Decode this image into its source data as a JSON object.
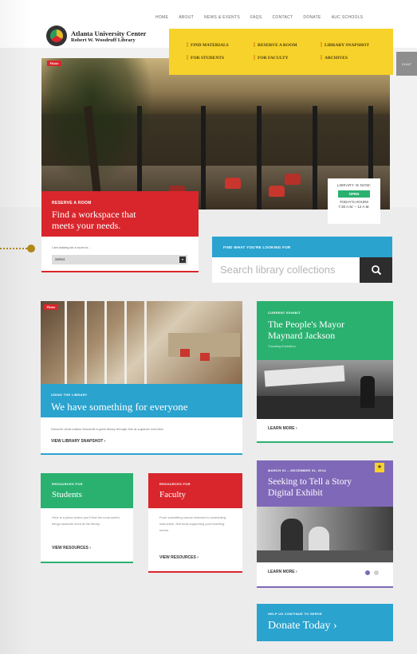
{
  "topnav": [
    "HOME",
    "ABOUT",
    "NEWS & EVENTS",
    "FAQS",
    "CONTACT",
    "DONATE",
    "AUC SCHOOLS"
  ],
  "logo": {
    "line1": "Atlanta University Center",
    "line2": "Robert W. Woodruff Library"
  },
  "menu": {
    "find_materials": "FIND MATERIALS",
    "reserve_room": "RESERVE A ROOM",
    "library_snapshot": "LIBRARY SNAPSHOT",
    "for_students": "FOR STUDENTS",
    "for_faculty": "FOR FACULTY",
    "archives": "ARCHIVES"
  },
  "chat_tab": "CHAT",
  "hero": {
    "tag": "Flickr"
  },
  "library_status": {
    "label": "LIBRARY IS NOW:",
    "state": "OPEN",
    "hours_label": "TODAY'S HOURS",
    "hours": "7:30 A.M. – 12 A.M."
  },
  "reserve": {
    "eyebrow": "RESERVE A ROOM",
    "headline_1": "Find a workspace that",
    "headline_2": "meets your needs.",
    "select_label": "I am looking for a room to...",
    "select_value": "Select"
  },
  "search": {
    "eyebrow": "FIND WHAT YOU'RE LOOKING FOR",
    "placeholder": "Search library collections"
  },
  "using": {
    "tag": "Flickr",
    "eyebrow": "USING THE LIBRARY",
    "headline": "We have something for everyone",
    "desc": "Discover what makes Woodruff a great library through this at-a-glance overview.",
    "link": "VIEW LIBRARY SNAPSHOT ›"
  },
  "exhibit": {
    "eyebrow": "CURRENT EXHIBIT",
    "headline_1": "The People's Mayor",
    "headline_2": "Maynard Jackson",
    "sub": "Traveling Exhibition",
    "link": "LEARN MORE ›"
  },
  "students": {
    "eyebrow": "RESOURCES FOR",
    "headline": "Students",
    "desc": "Here is a place where you'll find the most useful things students need at the library.",
    "link": "VIEW RESOURCES ›"
  },
  "faculty": {
    "eyebrow": "RESOURCES FOR",
    "headline": "Faculty",
    "desc": "From submitting course reserves to scheduling instruction, find tools supporting your teaching needs.",
    "link": "VIEW RESOURCES ›"
  },
  "story": {
    "star": "★",
    "eyebrow": "MARCH 01 – DECEMBER 31, 2014",
    "headline_1": "Seeking to Tell a Story",
    "headline_2": "Digital Exhibit",
    "link": "LEARN MORE ›"
  },
  "donate": {
    "eyebrow": "HELP US CONTINUE TO SERVE",
    "headline": "Donate Today ›"
  },
  "colors": {
    "red": "#d9262c",
    "yellow": "#f7d22a",
    "green": "#2ab170",
    "blue": "#2aa3cf",
    "purple": "#7f68b8"
  }
}
